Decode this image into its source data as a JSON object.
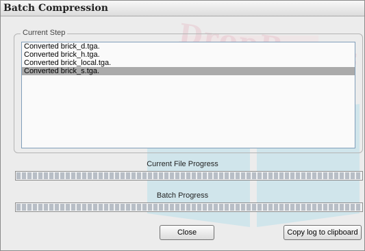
{
  "window": {
    "title": "Batch Compression"
  },
  "watermark": {
    "text": "DropBooks"
  },
  "current_step": {
    "label": "Current Step",
    "log": [
      {
        "text": "Converted brick_d.tga.",
        "selected": false
      },
      {
        "text": "Converted brick_h.tga.",
        "selected": false
      },
      {
        "text": "Converted brick_local.tga.",
        "selected": false
      },
      {
        "text": "Converted brick_s.tga.",
        "selected": true
      }
    ]
  },
  "file_progress": {
    "label": "Current File Progress",
    "value": 1.0
  },
  "batch_progress": {
    "label": "Batch Progress",
    "value": 1.0
  },
  "buttons": {
    "close": "Close",
    "copy_log": "Copy log to clipboard"
  },
  "colors": {
    "selection": "#aaaaaa",
    "progress_segment": "#b8bec6"
  }
}
